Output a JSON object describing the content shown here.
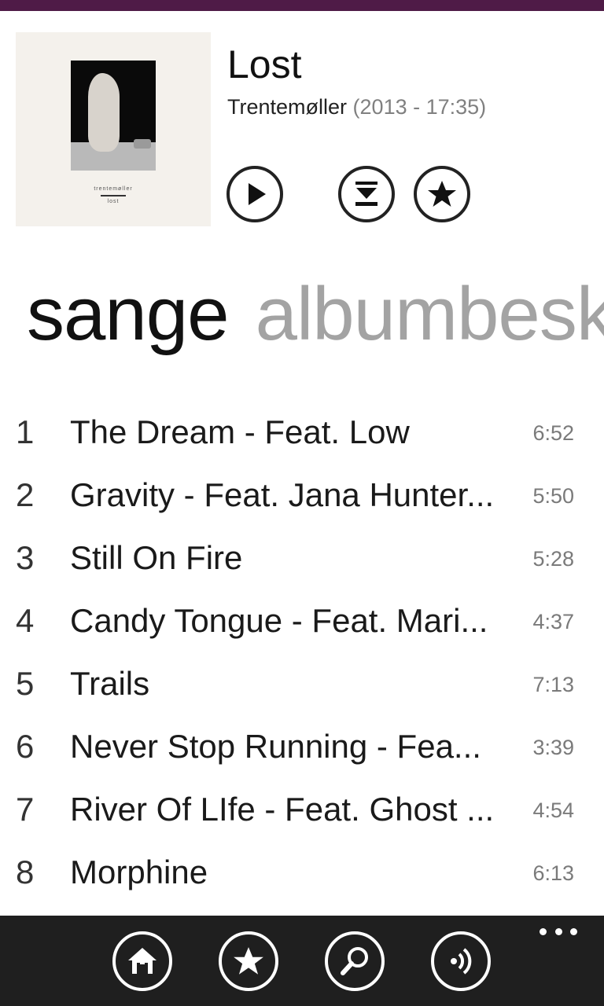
{
  "album": {
    "title": "Lost",
    "artist": "Trentemøller",
    "meta": "(2013 - 17:35)",
    "cover": {
      "artist_text": "trentemøller",
      "title_text": "lost"
    }
  },
  "actions": {
    "play_icon": "play-icon",
    "download_icon": "download-icon",
    "favorite_icon": "star-icon"
  },
  "pivot": {
    "active": "sange",
    "inactive": "albumbesk"
  },
  "tracks": [
    {
      "num": "1",
      "title": "The Dream - Feat. Low",
      "duration": "6:52"
    },
    {
      "num": "2",
      "title": "Gravity - Feat. Jana Hunter...",
      "duration": "5:50"
    },
    {
      "num": "3",
      "title": "Still On Fire",
      "duration": "5:28"
    },
    {
      "num": "4",
      "title": "Candy Tongue - Feat. Mari...",
      "duration": "4:37"
    },
    {
      "num": "5",
      "title": "Trails",
      "duration": "7:13"
    },
    {
      "num": "6",
      "title": "Never Stop Running - Fea...",
      "duration": "3:39"
    },
    {
      "num": "7",
      "title": "River Of LIfe - Feat. Ghost ...",
      "duration": "4:54"
    },
    {
      "num": "8",
      "title": "Morphine",
      "duration": "6:13"
    }
  ],
  "appbar": {
    "buttons": [
      "home-icon",
      "star-icon",
      "search-icon",
      "play-to-icon"
    ],
    "more": "more-icon"
  },
  "colors": {
    "accent": "#4f1b47",
    "appbar": "#1f1f1f",
    "inactive_text": "#a3a3a3"
  }
}
